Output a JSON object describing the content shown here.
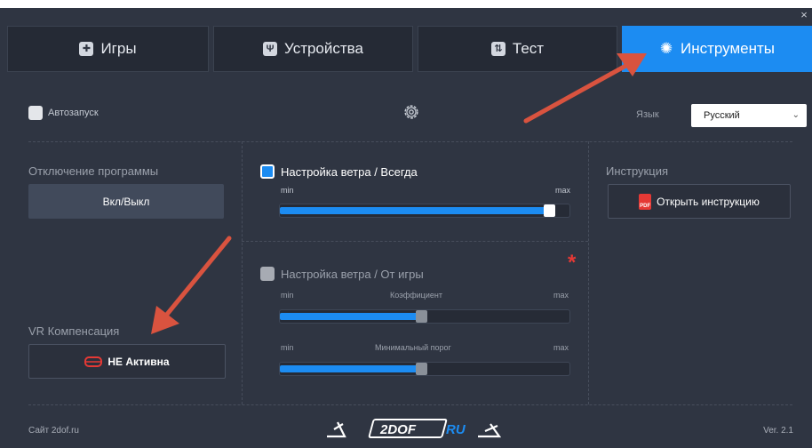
{
  "window": {
    "close_glyph": "×"
  },
  "tabs": [
    {
      "label": "Игры",
      "icon": "gamepad-icon",
      "active": false
    },
    {
      "label": "Устройства",
      "icon": "usb-icon",
      "active": false
    },
    {
      "label": "Тест",
      "icon": "sliders-icon",
      "active": false
    },
    {
      "label": "Инструменты",
      "icon": "gear-icon",
      "active": true
    }
  ],
  "top_row": {
    "autostart_label": "Автозапуск",
    "autostart_checked": false,
    "language_label": "Язык",
    "language_value": "Русский"
  },
  "left_column": {
    "shutdown_title": "Отключение программы",
    "toggle_button": "Вкл/Выкл",
    "vr_title": "VR Компенсация",
    "vr_button": "НЕ Активна"
  },
  "wind_always": {
    "title": "Настройка ветра / Всегда",
    "checked": true,
    "min_label": "min",
    "max_label": "max",
    "level": 0.95
  },
  "wind_game": {
    "title": "Настройка ветра / От игры",
    "checked": false,
    "min_label": "min",
    "max_label": "max",
    "coef_label": "Коэффициент",
    "coef_level": 0.49,
    "threshold_label": "Минимальный порог",
    "threshold_level": 0.49,
    "asterisk": "*"
  },
  "right_column": {
    "instruction_title": "Инструкция",
    "open_button": "Открыть инструкцию"
  },
  "footer": {
    "site": "Сайт 2dof.ru",
    "logo_text": "2DOF",
    "logo_suffix": "RU",
    "version": "Ver. 2.1"
  },
  "colors": {
    "accent": "#1c8cf2",
    "background": "#2f3542",
    "tab_background": "#252a35",
    "danger": "#e53935"
  }
}
